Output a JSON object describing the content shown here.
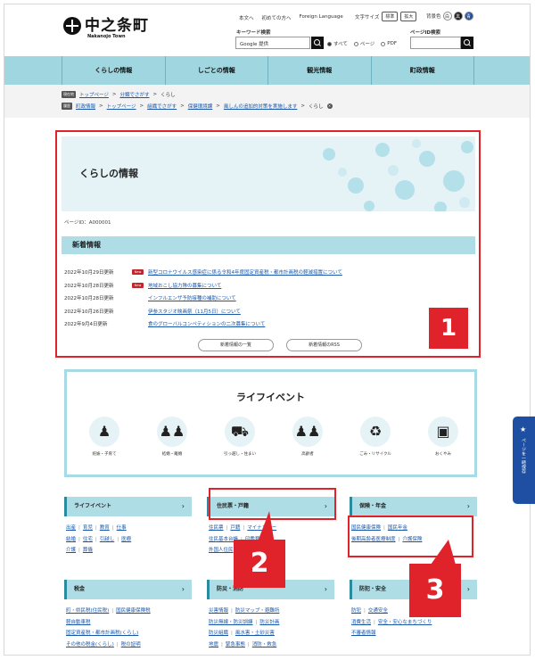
{
  "header": {
    "logo_title": "中之条町",
    "logo_sub": "Nakanojo Town",
    "links": [
      "本文へ",
      "初めての方へ",
      "Foreign Language"
    ],
    "font_size_label": "文字サイズ",
    "font_size_options": [
      "標準",
      "拡大"
    ],
    "bg_color_label": "背景色",
    "bg_color_options": [
      "白",
      "黒",
      "青"
    ],
    "keyword_label": "キーワード検索",
    "keyword_value": "Google 提供",
    "scope_options": [
      "すべて",
      "ページ",
      "PDF"
    ],
    "pageid_label": "ページID検索"
  },
  "nav": [
    "くらしの情報",
    "しごとの情報",
    "観光情報",
    "町政情報"
  ],
  "breadcrumbs": {
    "row1": {
      "tag": "現在地",
      "items": [
        "トップページ",
        "分類でさがす",
        "くらし"
      ]
    },
    "row2": {
      "tag": "履歴",
      "items": [
        "町政情報",
        "トップページ",
        "組織でさがす",
        "保健環境課",
        "風しんの追加的対策を実施します",
        "くらし"
      ]
    }
  },
  "main": {
    "title": "くらしの情報",
    "page_id": "ページID：A000001",
    "news_header": "新着情報",
    "news": [
      {
        "date": "2022年10月29日更新",
        "new": "New",
        "text": "新型コロナウイルス感染症に係る令和4年度固定資産税・都市計画税の軽減措置について"
      },
      {
        "date": "2022年10月28日更新",
        "new": "New",
        "text": "地域おこし協力隊の募集について"
      },
      {
        "date": "2022年10月28日更新",
        "new": "",
        "text": "インフルエンザ予防接種の補助について"
      },
      {
        "date": "2022年10月26日更新",
        "new": "",
        "text": "伊参スタジオ映画祭（11月5日）について"
      },
      {
        "date": "2022年9月4日更新",
        "new": "",
        "text": "食のグローバルコンペティションの二次募集について"
      }
    ],
    "buttons": [
      "新着情報の一覧",
      "新着情報のRSS"
    ]
  },
  "life_events": {
    "title": "ライフイベント",
    "items": [
      "妊娠・子育て",
      "結婚・離婚",
      "引っ越し・住まい",
      "高齢者",
      "ごみ・リサイクル",
      "おくやみ"
    ]
  },
  "categories": [
    {
      "title": "ライフイベント",
      "links": [
        "出産",
        "育児",
        "教育",
        "仕事",
        "結婚",
        "住宅",
        "引越し",
        "医療",
        "介護",
        "葬儀"
      ]
    },
    {
      "title": "住民票・戸籍",
      "links": [
        "住民票",
        "戸籍",
        "マイナンバー",
        "住民基本台帳",
        "印鑑登録",
        "外国人住民"
      ]
    },
    {
      "title": "保険・年金",
      "links": [
        "国民健康保険",
        "国民年金",
        "後期高齢者医療制度",
        "介護保険"
      ]
    },
    {
      "title": "税金",
      "links": [
        "町・県民税(住民税)",
        "国民健康保険税",
        "軽自動車税",
        "固定資産税・都市計画税(くらし)",
        "その他の税金(くらし)",
        "税の証明"
      ]
    },
    {
      "title": "防災・消防",
      "links": [
        "災害情報",
        "防災マップ・避難所",
        "防災無線・防災訓練",
        "防災計画",
        "防災組織",
        "風水害・土砂災害",
        "地震",
        "緊急事態",
        "消防・救急"
      ]
    },
    {
      "title": "防犯・安全",
      "links": [
        "防犯",
        "交通安全",
        "消費生活",
        "安全・安心なまちづくり",
        "不審者情報"
      ]
    }
  ],
  "side_tab": {
    "star": "★",
    "text": "ページを一時保存"
  },
  "callouts": [
    "1",
    "2",
    "3"
  ],
  "colors": {
    "nav": "#9fd6e0",
    "accent_red": "#e0232b",
    "side_tab": "#1f4fa3",
    "header_box": "#aedde6"
  }
}
